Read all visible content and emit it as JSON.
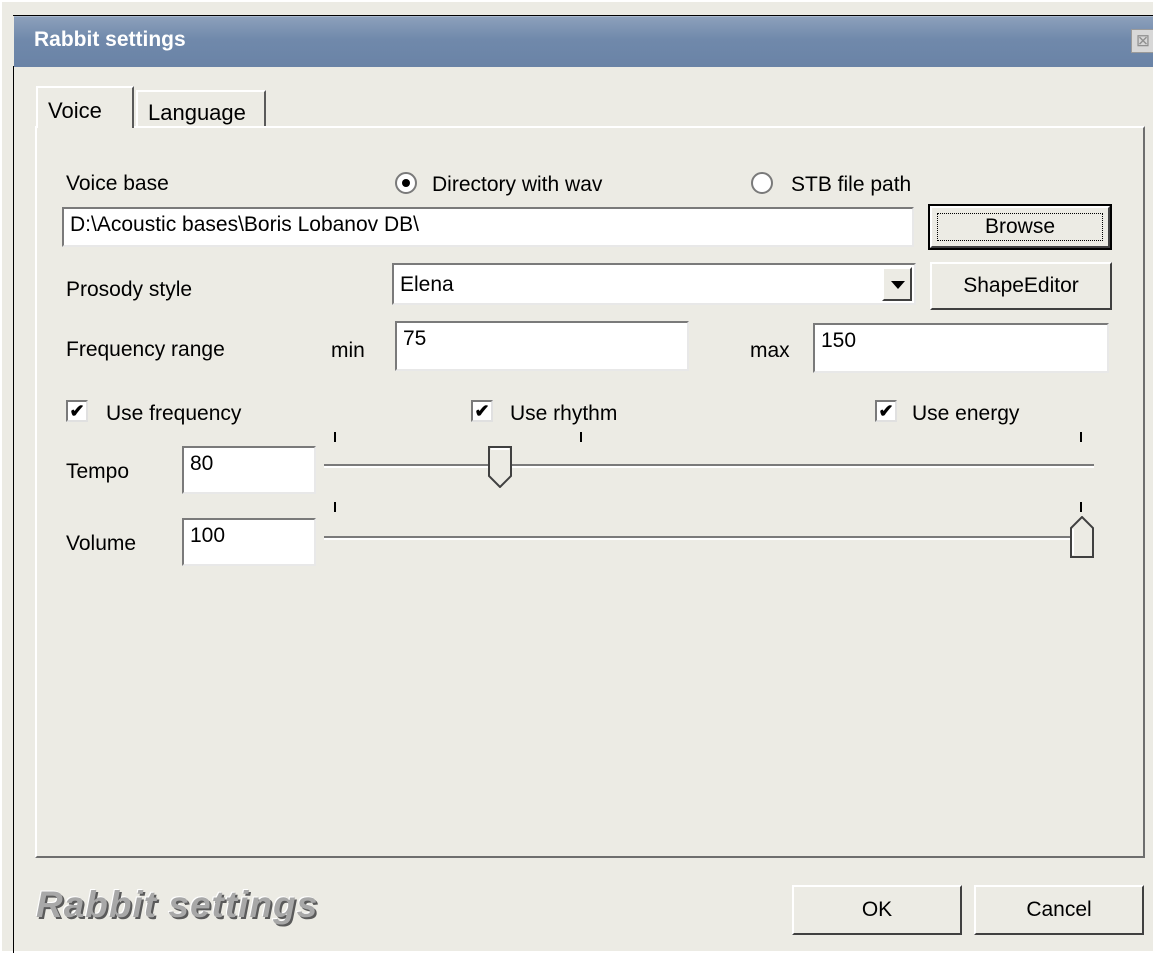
{
  "window": {
    "title": "Rabbit settings",
    "close_glyph": "⊠"
  },
  "tabs": [
    {
      "label": "Voice",
      "selected": true
    },
    {
      "label": "Language",
      "selected": false
    }
  ],
  "voice_base": {
    "label": "Voice base",
    "radio_directory": {
      "label": "Directory with wav",
      "checked": true
    },
    "radio_stb": {
      "label": "STB file path",
      "checked": false
    },
    "path_value": "D:\\Acoustic bases\\Boris Lobanov DB\\",
    "browse_label": "Browse"
  },
  "prosody": {
    "label": "Prosody style",
    "selected": "Elena",
    "shape_editor_label": "ShapeEditor"
  },
  "frequency": {
    "label": "Frequency range",
    "min_label": "min",
    "min_value": "75",
    "max_label": "max",
    "max_value": "150"
  },
  "checkboxes": [
    {
      "label": "Use frequency",
      "checked": true
    },
    {
      "label": "Use rhythm",
      "checked": true
    },
    {
      "label": "Use energy",
      "checked": true
    }
  ],
  "check_glyph": "✔",
  "tempo": {
    "label": "Tempo",
    "value": "80",
    "slider_fraction": 0.22
  },
  "volume": {
    "label": "Volume",
    "value": "100",
    "slider_fraction": 1.0
  },
  "footer": {
    "brand": "Rabbit settings",
    "ok_label": "OK",
    "cancel_label": "Cancel"
  },
  "colors": {
    "titlebar": "#7089ab",
    "face": "#ecebe4"
  }
}
